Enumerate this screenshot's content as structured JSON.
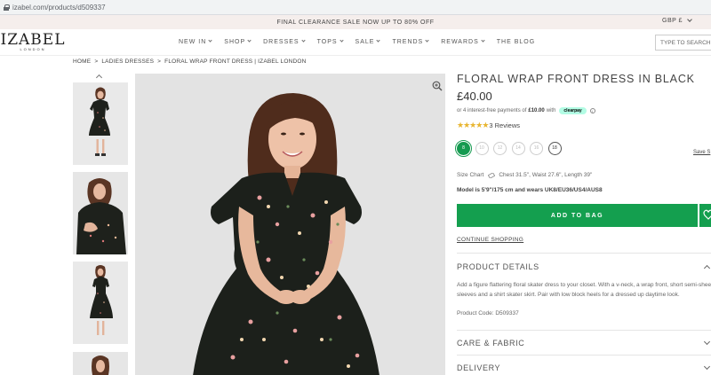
{
  "browser": {
    "url": "izabel.com/products/d509337"
  },
  "promo": {
    "text": "FINAL CLEARANCE SALE NOW UP TO 80% OFF",
    "currency": "GBP £"
  },
  "logo": {
    "main": "IZABEL",
    "sub": "LONDON"
  },
  "nav": [
    {
      "label": "NEW IN"
    },
    {
      "label": "SHOP"
    },
    {
      "label": "DRESSES"
    },
    {
      "label": "TOPS"
    },
    {
      "label": "SALE"
    },
    {
      "label": "TRENDS"
    },
    {
      "label": "REWARDS"
    },
    {
      "label": "THE BLOG"
    }
  ],
  "search": {
    "placeholder": "TYPE TO SEARCH"
  },
  "breadcrumb": {
    "home": "HOME",
    "sep": ">",
    "category": "LADIES DRESSES",
    "current": "FLORAL WRAP FRONT DRESS | IZABEL LONDON"
  },
  "product": {
    "title": "FLORAL WRAP FRONT DRESS IN BLACK",
    "price": "£40.00",
    "clearpay_pre": "or 4 interest-free payments of",
    "clearpay_amount": "£10.00",
    "clearpay_with": "with",
    "clearpay_badge": "clearpay",
    "rating": 5,
    "reviews": "3 Reviews",
    "sizes": [
      "8",
      "10",
      "12",
      "14",
      "16",
      "18"
    ],
    "selected_size": "8",
    "save_link": "Save S",
    "size_chart_label": "Size Chart",
    "measurements": "Chest 31.5\", Waist 27.6\", Length 39\"",
    "model_info": "Model is 5'9\"/175 cm and wears UK8/EU36/US4/AUS8",
    "add_to_bag": "ADD TO BAG",
    "continue": "CONTINUE SHOPPING",
    "details_heading": "PRODUCT DETAILS",
    "details_text": "Add a figure flattering floral skater dress to your closet. With a v-neck, a wrap front, short semi-sheer sleeves and a shirt skater skirt. Pair with low block heels for a dressed up daytime look.",
    "product_code": "Product Code: D509337",
    "care_heading": "CARE & FABRIC",
    "delivery_heading": "DELIVERY"
  },
  "colors": {
    "accent_green": "#149f4f",
    "promo_bg": "#f5eeec",
    "clearpay_mint": "#b2fce4",
    "star": "#e8b530"
  }
}
